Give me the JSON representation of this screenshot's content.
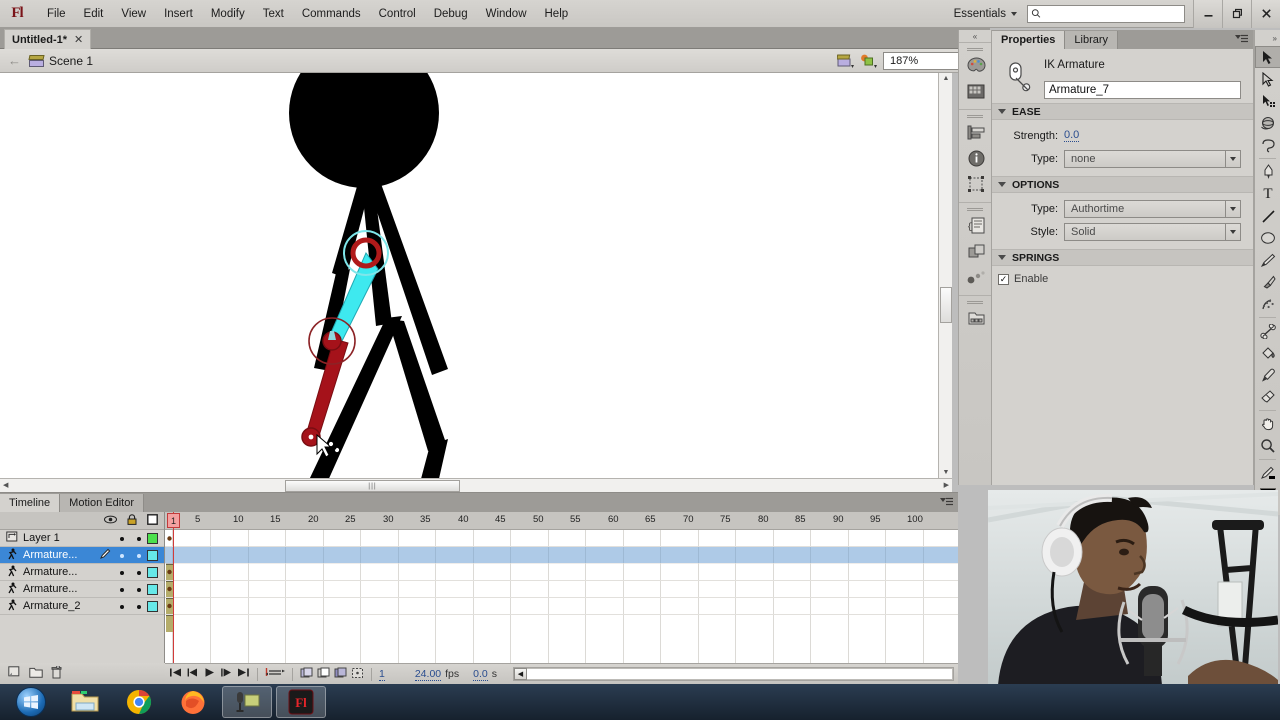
{
  "app": {
    "logo": "Fl",
    "menus": [
      "File",
      "Edit",
      "View",
      "Insert",
      "Modify",
      "Text",
      "Commands",
      "Control",
      "Debug",
      "Window",
      "Help"
    ],
    "workspace": "Essentials",
    "search_placeholder": "",
    "search_value": "",
    "window_buttons": {
      "minimize": "—",
      "restore": "❐",
      "close": "✕"
    },
    "icons": {
      "search": "search-icon",
      "workspace_caret": "chevron-down-icon"
    }
  },
  "document": {
    "tab_label": "Untitled-1*",
    "tab_close": "✕",
    "breadcrumb_back": "back-arrow-icon",
    "scene": "Scene 1",
    "zoom": "187%",
    "edit_scene_icon": "edit-scene-icon",
    "edit_symbols_icon": "edit-symbols-icon"
  },
  "properties": {
    "tabs": [
      {
        "label": "Properties",
        "active": true
      },
      {
        "label": "Library",
        "active": false
      }
    ],
    "panel_menu_icon": "panel-menu-icon",
    "object_type": "IK Armature",
    "object_icon": "bone-icon",
    "name_value": "Armature_7",
    "sections": [
      {
        "title": "EASE",
        "rows": [
          {
            "label": "Strength:",
            "type": "hotnumber",
            "value": "0.0"
          },
          {
            "label": "Type:",
            "type": "select",
            "value": "none"
          }
        ]
      },
      {
        "title": "OPTIONS",
        "rows": [
          {
            "label": "Type:",
            "type": "select",
            "value": "Authortime"
          },
          {
            "label": "Style:",
            "type": "select",
            "value": "Solid"
          }
        ]
      },
      {
        "title": "SPRINGS",
        "rows": [
          {
            "label": "Enable",
            "type": "checkbox",
            "value": "✓"
          }
        ]
      }
    ]
  },
  "icon_dock": {
    "collapse_icon": "collapse-panel-icon",
    "groups": [
      [
        "color-palette-icon",
        "color-swatches-icon"
      ],
      [
        "align-icon",
        "info-icon",
        "transform-icon"
      ],
      [
        "code-snippets-icon",
        "components-icon",
        "motion-presets-icon"
      ],
      [
        "library-folder-icon"
      ]
    ]
  },
  "tools": {
    "collapse_icon": "collapse-tools-icon",
    "items": [
      {
        "name": "selection-tool",
        "active": true
      },
      {
        "name": "subselection-tool",
        "active": false
      },
      {
        "name": "free-transform-tool",
        "active": false
      },
      {
        "name": "3d-rotation-tool",
        "active": false
      },
      {
        "name": "lasso-tool",
        "active": false
      },
      {
        "name": "pen-tool",
        "active": false
      },
      {
        "name": "text-tool",
        "active": false
      },
      {
        "name": "line-tool",
        "active": false
      },
      {
        "name": "oval-tool",
        "active": false
      },
      {
        "name": "pencil-tool",
        "active": false
      },
      {
        "name": "brush-tool",
        "active": false
      },
      {
        "name": "deco-tool",
        "active": false
      },
      {
        "name": "bone-tool",
        "active": false
      },
      {
        "name": "paint-bucket-tool",
        "active": false
      },
      {
        "name": "eyedropper-tool",
        "active": false
      },
      {
        "name": "eraser-tool",
        "active": false
      },
      {
        "name": "hand-tool",
        "active": false
      },
      {
        "name": "zoom-tool",
        "active": false
      }
    ],
    "stroke_color": "#000000",
    "fill_color": "#000000"
  },
  "timeline": {
    "tabs": [
      {
        "label": "Timeline",
        "active": true
      },
      {
        "label": "Motion Editor",
        "active": false
      }
    ],
    "header_icons": {
      "eye": "eye-icon",
      "lock": "lock-icon",
      "outline": "outline-square-icon"
    },
    "ruler_labels": [
      "1",
      "5",
      "10",
      "15",
      "20",
      "25",
      "30",
      "35",
      "40",
      "45",
      "50",
      "55",
      "60",
      "65",
      "70",
      "75",
      "80",
      "85",
      "90",
      "95",
      "100"
    ],
    "playhead_frame": "1",
    "layers": [
      {
        "name": "Layer 1",
        "icon": "layer-icon",
        "color": "#4CE04C",
        "selected": false,
        "armature": false,
        "pencil": false
      },
      {
        "name": "Armature...",
        "icon": "armature-icon",
        "color": "#66E8E8",
        "selected": true,
        "armature": true,
        "pencil": true
      },
      {
        "name": "Armature...",
        "icon": "armature-icon",
        "color": "#66E8E8",
        "selected": false,
        "armature": true,
        "pencil": false
      },
      {
        "name": "Armature...",
        "icon": "armature-icon",
        "color": "#66E8E8",
        "selected": false,
        "armature": true,
        "pencil": false
      },
      {
        "name": "Armature_2",
        "icon": "armature-icon",
        "color": "#66E8E8",
        "selected": false,
        "armature": true,
        "pencil": false
      }
    ],
    "layer_buttons": [
      "new-layer-icon",
      "new-folder-icon",
      "delete-layer-icon"
    ],
    "footer": {
      "controls": [
        "go-to-first-icon",
        "step-back-icon",
        "play-icon",
        "step-forward-icon",
        "go-to-last-icon",
        "loop-icon"
      ],
      "onion_icons": [
        "onion-skin-icon",
        "onion-skin-outlines-icon",
        "edit-multiple-frames-icon",
        "modify-markers-icon"
      ],
      "current_frame": "1",
      "fps_value": "24.00",
      "fps_label": "fps",
      "elapsed_value": "0.0",
      "elapsed_label": "s"
    }
  },
  "stage": {
    "background": "#ffffff",
    "selected_bone_color": "#2ee6e6",
    "bone_color": "#a01217",
    "joint_ring_color": "#b01a1a",
    "cursor": "bone-cursor-icon",
    "scroll": {
      "vertical": "stage-vertical-scrollbar",
      "horizontal": "stage-horizontal-scrollbar"
    }
  },
  "taskbar": {
    "start": "windows-start-orb",
    "items": [
      "file-explorer-icon",
      "google-chrome-icon",
      "mozilla-firefox-icon",
      "screen-recorder-icon",
      "adobe-flash-icon"
    ],
    "active_item": "adobe-flash-icon"
  },
  "webcam": {
    "label": "webcam-overlay"
  }
}
